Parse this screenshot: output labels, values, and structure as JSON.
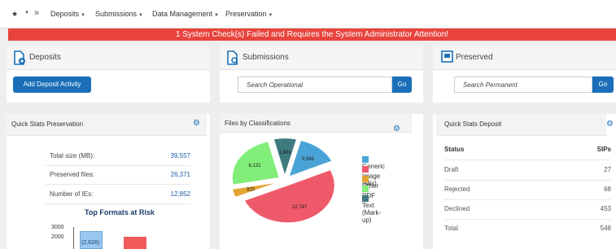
{
  "nav": {
    "items": [
      "Deposits",
      "Submissions",
      "Data Management",
      "Preservation"
    ],
    "star_icon": "star-icon",
    "chevrons_icon": "double-chevron-icon"
  },
  "alert": {
    "text": "1 System Check(s) Failed and Requires the System Administrator Attention!",
    "color": "#e8443d"
  },
  "deposits": {
    "title": "Deposits",
    "button": "Add Deposit Activity"
  },
  "submissions": {
    "title": "Submissions",
    "search_placeholder": "Search Operational",
    "go": "Go"
  },
  "preserved": {
    "title": "Preserved",
    "search_placeholder": "Search Permanent",
    "go": "Go"
  },
  "quick_stats_preservation": {
    "title": "Quick Stats Preservation",
    "rows": [
      {
        "label": "Total size (MB):",
        "value": "39,557"
      },
      {
        "label": "Preserved files:",
        "value": "26,371"
      },
      {
        "label": "Number of IEs:",
        "value": "12,852"
      }
    ],
    "top_formats": {
      "title": "Top Formats at Risk",
      "ticks": [
        "3000",
        "2000"
      ],
      "bar_label": "(2,626)"
    }
  },
  "files_by_classifications": {
    "title": "Files by Classifications",
    "chart_data": {
      "type": "pie",
      "slices": [
        {
          "name": "Generic",
          "value": 3596,
          "label": "3,596",
          "color": "#4aa3d6"
        },
        {
          "name": "Image (Mix)",
          "value": 12747,
          "label": "12,747",
          "color": "#ef5a6a"
        },
        {
          "name": "Other",
          "value": 920,
          "label": "920",
          "color": "#e3a532"
        },
        {
          "name": "PDF",
          "value": 6131,
          "label": "6,131",
          "color": "#82ee7a"
        },
        {
          "name": "Text (Mark-up)",
          "value": 1981,
          "label": "1,981",
          "color": "#3e7a7e"
        }
      ],
      "legend": "right"
    }
  },
  "quick_stats_deposit": {
    "title": "Quick Stats Deposit",
    "header": {
      "status": "Status",
      "sips": "SIPs"
    },
    "rows": [
      {
        "label": "Draft",
        "value": "27"
      },
      {
        "label": "Rejected",
        "value": "68"
      },
      {
        "label": "Declined",
        "value": "453"
      },
      {
        "label": "Total",
        "value": "548"
      }
    ]
  },
  "colors": {
    "accent": "#1a6fb8",
    "alert": "#e8443d"
  }
}
